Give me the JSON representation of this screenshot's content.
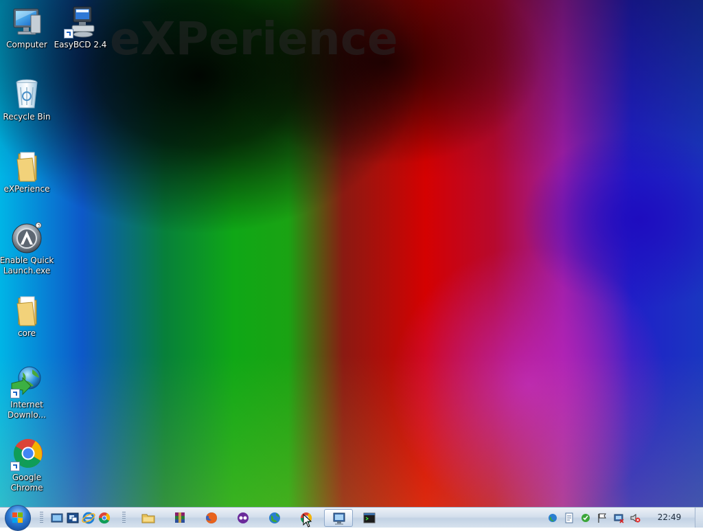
{
  "desktop": {
    "watermark": "eXPerience",
    "icons": [
      {
        "label": "Computer"
      },
      {
        "label": "EasyBCD 2.4"
      },
      {
        "label": "Recycle Bin"
      },
      {
        "label": "eXPerience"
      },
      {
        "label": "Enable Quick Launch.exe",
        "line1": "Enable Quick",
        "line2": "Launch.exe"
      },
      {
        "label": "core"
      },
      {
        "label": "Internet Downlo...",
        "line1": "Internet",
        "line2": "Downlo..."
      },
      {
        "label": "Google Chrome",
        "line1": "Google",
        "line2": "Chrome"
      }
    ]
  },
  "taskbar": {
    "start_icon": "windows-orb-icon",
    "quick_launch": [
      "show-desktop-icon",
      "switch-windows-icon",
      "internet-explorer-icon",
      "chrome-icon"
    ],
    "pinned": [
      "file-explorer-icon",
      "winrar-icon",
      "firefox-icon",
      "messenger-icon",
      "globe-icon",
      "chrome-icon"
    ],
    "running": [
      "network-window-icon",
      "cmd-icon"
    ],
    "tray": [
      "network-icon",
      "notes-icon",
      "security-icon",
      "action-center-flag-icon",
      "network-status-icon",
      "volume-muted-icon"
    ],
    "clock": "22:49"
  },
  "colors": {
    "taskbar": "#d4dfec",
    "label_text": "#ffffff"
  }
}
